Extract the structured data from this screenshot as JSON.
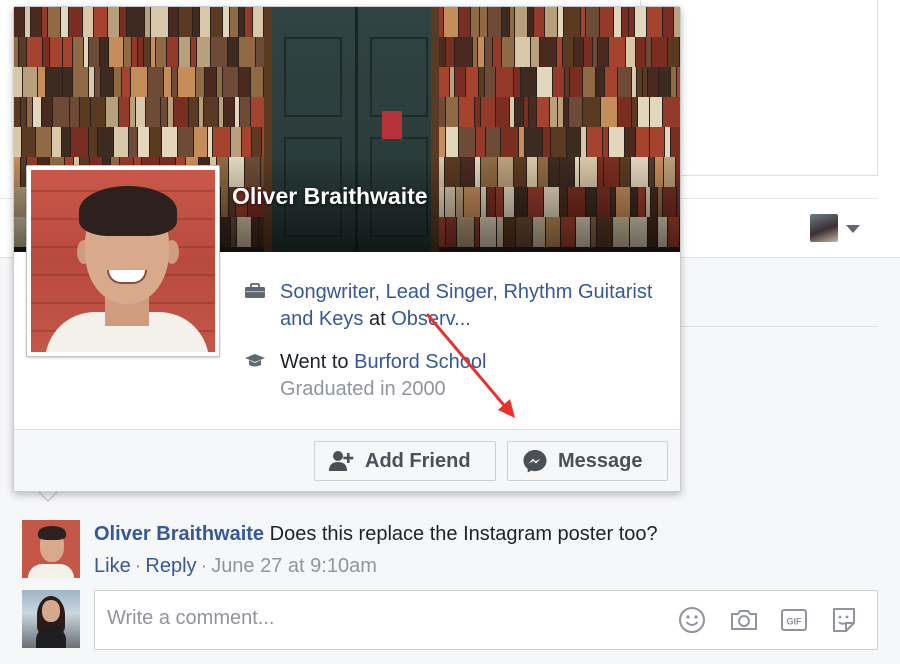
{
  "hovercard": {
    "name": "Oliver Braithwaite",
    "work": {
      "icon": "briefcase-icon",
      "role": "Songwriter, Lead Singer, Rhythm Guitarist and Keys",
      "connector": "at",
      "company": "Observ..."
    },
    "education": {
      "icon": "graduation-cap-icon",
      "prefix": "Went to",
      "school": "Burford School",
      "graduated": "Graduated in 2000"
    },
    "buttons": {
      "add_friend": "Add Friend",
      "message": "Message"
    }
  },
  "comment": {
    "author": "Oliver Braithwaite",
    "text": "Does this replace the Instagram poster too?",
    "like": "Like",
    "reply": "Reply",
    "timestamp": "June 27 at 9:10am"
  },
  "composer": {
    "placeholder": "Write a comment..."
  },
  "colors": {
    "link": "#365899",
    "annotation_arrow": "#e8322b"
  }
}
